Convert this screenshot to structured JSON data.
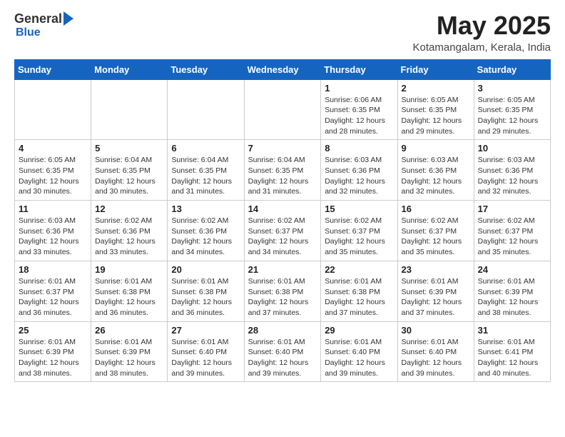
{
  "logo": {
    "general": "General",
    "blue": "Blue"
  },
  "title": "May 2025",
  "location": "Kotamangalam, Kerala, India",
  "days_of_week": [
    "Sunday",
    "Monday",
    "Tuesday",
    "Wednesday",
    "Thursday",
    "Friday",
    "Saturday"
  ],
  "weeks": [
    [
      {
        "day": "",
        "info": ""
      },
      {
        "day": "",
        "info": ""
      },
      {
        "day": "",
        "info": ""
      },
      {
        "day": "",
        "info": ""
      },
      {
        "day": "1",
        "info": "Sunrise: 6:06 AM\nSunset: 6:35 PM\nDaylight: 12 hours\nand 28 minutes."
      },
      {
        "day": "2",
        "info": "Sunrise: 6:05 AM\nSunset: 6:35 PM\nDaylight: 12 hours\nand 29 minutes."
      },
      {
        "day": "3",
        "info": "Sunrise: 6:05 AM\nSunset: 6:35 PM\nDaylight: 12 hours\nand 29 minutes."
      }
    ],
    [
      {
        "day": "4",
        "info": "Sunrise: 6:05 AM\nSunset: 6:35 PM\nDaylight: 12 hours\nand 30 minutes."
      },
      {
        "day": "5",
        "info": "Sunrise: 6:04 AM\nSunset: 6:35 PM\nDaylight: 12 hours\nand 30 minutes."
      },
      {
        "day": "6",
        "info": "Sunrise: 6:04 AM\nSunset: 6:35 PM\nDaylight: 12 hours\nand 31 minutes."
      },
      {
        "day": "7",
        "info": "Sunrise: 6:04 AM\nSunset: 6:35 PM\nDaylight: 12 hours\nand 31 minutes."
      },
      {
        "day": "8",
        "info": "Sunrise: 6:03 AM\nSunset: 6:36 PM\nDaylight: 12 hours\nand 32 minutes."
      },
      {
        "day": "9",
        "info": "Sunrise: 6:03 AM\nSunset: 6:36 PM\nDaylight: 12 hours\nand 32 minutes."
      },
      {
        "day": "10",
        "info": "Sunrise: 6:03 AM\nSunset: 6:36 PM\nDaylight: 12 hours\nand 32 minutes."
      }
    ],
    [
      {
        "day": "11",
        "info": "Sunrise: 6:03 AM\nSunset: 6:36 PM\nDaylight: 12 hours\nand 33 minutes."
      },
      {
        "day": "12",
        "info": "Sunrise: 6:02 AM\nSunset: 6:36 PM\nDaylight: 12 hours\nand 33 minutes."
      },
      {
        "day": "13",
        "info": "Sunrise: 6:02 AM\nSunset: 6:36 PM\nDaylight: 12 hours\nand 34 minutes."
      },
      {
        "day": "14",
        "info": "Sunrise: 6:02 AM\nSunset: 6:37 PM\nDaylight: 12 hours\nand 34 minutes."
      },
      {
        "day": "15",
        "info": "Sunrise: 6:02 AM\nSunset: 6:37 PM\nDaylight: 12 hours\nand 35 minutes."
      },
      {
        "day": "16",
        "info": "Sunrise: 6:02 AM\nSunset: 6:37 PM\nDaylight: 12 hours\nand 35 minutes."
      },
      {
        "day": "17",
        "info": "Sunrise: 6:02 AM\nSunset: 6:37 PM\nDaylight: 12 hours\nand 35 minutes."
      }
    ],
    [
      {
        "day": "18",
        "info": "Sunrise: 6:01 AM\nSunset: 6:37 PM\nDaylight: 12 hours\nand 36 minutes."
      },
      {
        "day": "19",
        "info": "Sunrise: 6:01 AM\nSunset: 6:38 PM\nDaylight: 12 hours\nand 36 minutes."
      },
      {
        "day": "20",
        "info": "Sunrise: 6:01 AM\nSunset: 6:38 PM\nDaylight: 12 hours\nand 36 minutes."
      },
      {
        "day": "21",
        "info": "Sunrise: 6:01 AM\nSunset: 6:38 PM\nDaylight: 12 hours\nand 37 minutes."
      },
      {
        "day": "22",
        "info": "Sunrise: 6:01 AM\nSunset: 6:38 PM\nDaylight: 12 hours\nand 37 minutes."
      },
      {
        "day": "23",
        "info": "Sunrise: 6:01 AM\nSunset: 6:39 PM\nDaylight: 12 hours\nand 37 minutes."
      },
      {
        "day": "24",
        "info": "Sunrise: 6:01 AM\nSunset: 6:39 PM\nDaylight: 12 hours\nand 38 minutes."
      }
    ],
    [
      {
        "day": "25",
        "info": "Sunrise: 6:01 AM\nSunset: 6:39 PM\nDaylight: 12 hours\nand 38 minutes."
      },
      {
        "day": "26",
        "info": "Sunrise: 6:01 AM\nSunset: 6:39 PM\nDaylight: 12 hours\nand 38 minutes."
      },
      {
        "day": "27",
        "info": "Sunrise: 6:01 AM\nSunset: 6:40 PM\nDaylight: 12 hours\nand 39 minutes."
      },
      {
        "day": "28",
        "info": "Sunrise: 6:01 AM\nSunset: 6:40 PM\nDaylight: 12 hours\nand 39 minutes."
      },
      {
        "day": "29",
        "info": "Sunrise: 6:01 AM\nSunset: 6:40 PM\nDaylight: 12 hours\nand 39 minutes."
      },
      {
        "day": "30",
        "info": "Sunrise: 6:01 AM\nSunset: 6:40 PM\nDaylight: 12 hours\nand 39 minutes."
      },
      {
        "day": "31",
        "info": "Sunrise: 6:01 AM\nSunset: 6:41 PM\nDaylight: 12 hours\nand 40 minutes."
      }
    ]
  ]
}
